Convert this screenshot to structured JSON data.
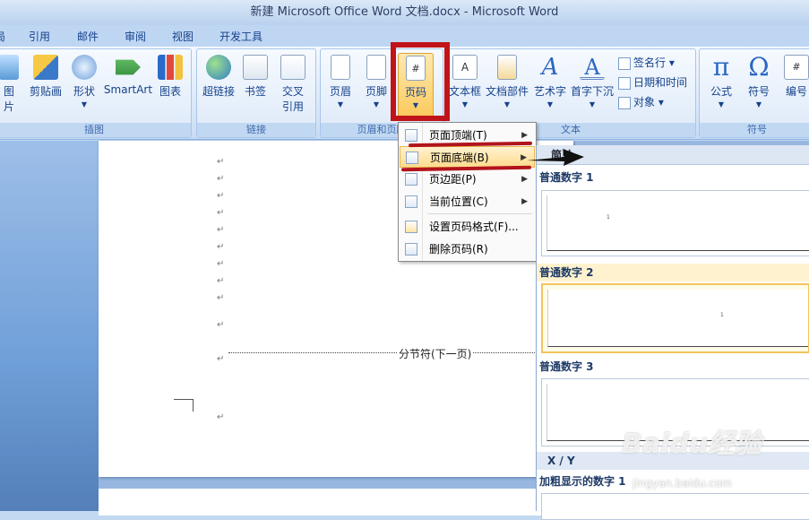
{
  "window": {
    "title": "新建 Microsoft Office Word 文档.docx - Microsoft Word"
  },
  "tabs": [
    "局",
    "引用",
    "邮件",
    "审阅",
    "视图",
    "开发工具"
  ],
  "ribbon": {
    "groups": {
      "illustrations": {
        "label": "插图",
        "buttons": [
          "图片",
          "剪贴画",
          "形状",
          "SmartArt",
          "图表"
        ]
      },
      "links": {
        "label": "链接",
        "buttons": [
          "超链接",
          "书签",
          "交叉\n引用"
        ]
      },
      "header_footer": {
        "label": "页眉和页脚",
        "buttons": [
          "页眉",
          "页脚",
          "页码"
        ]
      },
      "text": {
        "label": "文本",
        "buttons": [
          "文本框",
          "文档部件",
          "艺术字",
          "首字下沉"
        ],
        "small": [
          "签名行",
          "日期和时间",
          "对象"
        ]
      },
      "symbols": {
        "label": "符号",
        "buttons": [
          "公式",
          "符号",
          "编号"
        ]
      }
    }
  },
  "page_number_menu": {
    "items": [
      {
        "label": "页面顶端(T)",
        "submenu": true
      },
      {
        "label": "页面底端(B)",
        "submenu": true,
        "highlighted": true
      },
      {
        "label": "页边距(P)",
        "submenu": true
      },
      {
        "label": "当前位置(C)",
        "submenu": true
      },
      {
        "label": "设置页码格式(F)...",
        "submenu": false
      },
      {
        "label": "删除页码(R)",
        "submenu": false
      }
    ]
  },
  "gallery": {
    "header": "简单",
    "categories": [
      {
        "label": "普通数字 1",
        "sample": "1"
      },
      {
        "label": "普通数字 2",
        "sample": "1",
        "selected": true
      },
      {
        "label": "普通数字 3",
        "sample": ""
      }
    ],
    "section_xy": "X / Y",
    "bold_cat": "加粗显示的数字 1"
  },
  "document": {
    "para_mark": "↵",
    "section_break": "分节符(下一页)"
  },
  "watermark": {
    "text": "Baidu经验",
    "url": "jingyan.baidu.com"
  },
  "colors": {
    "annotation_red": "#c0141a",
    "ribbon_bg": "#dde9f8",
    "highlight": "#fedc8e"
  }
}
